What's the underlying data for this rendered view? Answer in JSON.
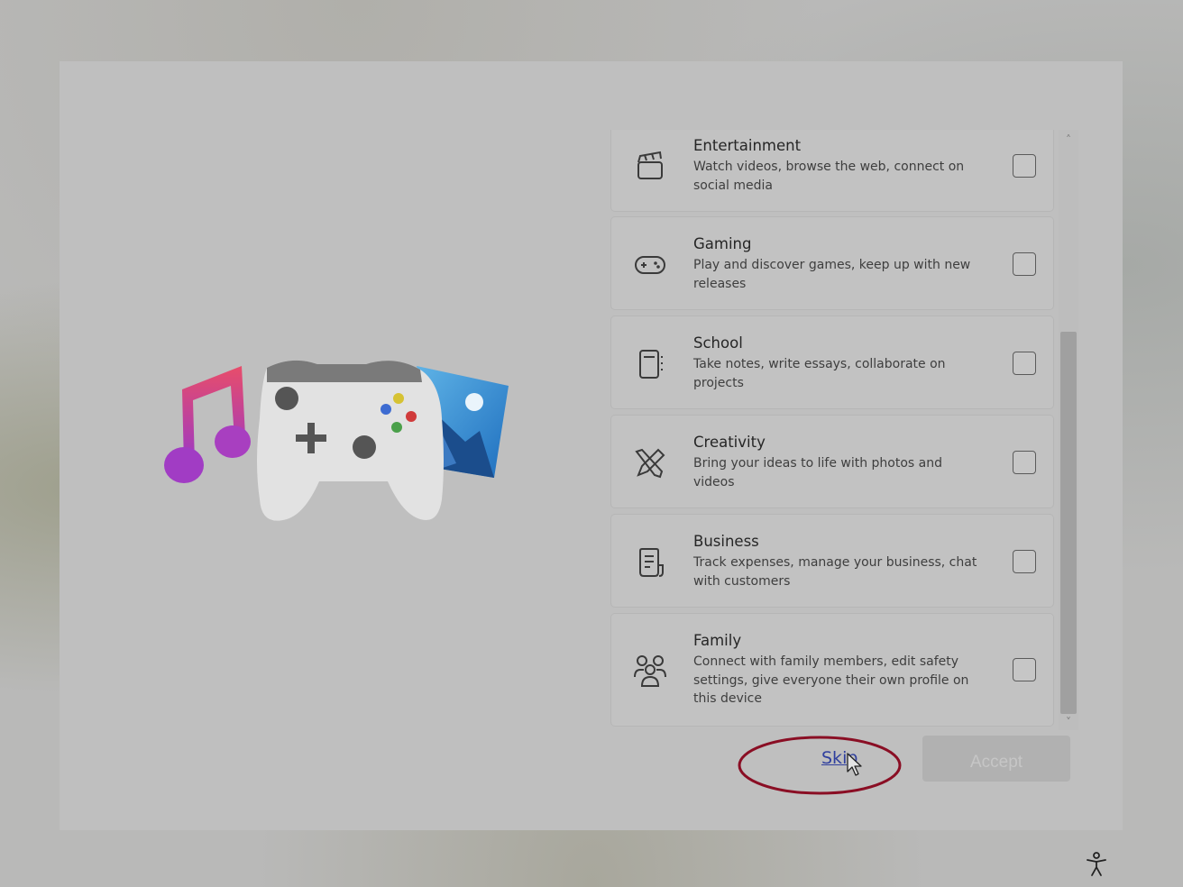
{
  "categories": [
    {
      "title": "Entertainment",
      "description": "Watch videos, browse the web, connect on social media",
      "icon": "clapperboard-icon",
      "checked": false
    },
    {
      "title": "Gaming",
      "description": "Play and discover games, keep up with new releases",
      "icon": "gamepad-icon",
      "checked": false
    },
    {
      "title": "School",
      "description": "Take notes, write essays, collaborate on projects",
      "icon": "notebook-icon",
      "checked": false
    },
    {
      "title": "Creativity",
      "description": "Bring your ideas to life with photos and videos",
      "icon": "pen-brush-icon",
      "checked": false
    },
    {
      "title": "Business",
      "description": "Track expenses, manage your business, chat with customers",
      "icon": "document-icon",
      "checked": false
    },
    {
      "title": "Family",
      "description": "Connect with family members, edit safety settings, give everyone their own profile on this device",
      "icon": "people-icon",
      "checked": false
    }
  ],
  "actions": {
    "skip_label": "Skip",
    "accept_label": "Accept"
  },
  "colors": {
    "link": "#2f3f9e",
    "highlight_oval": "#8a0e24"
  }
}
